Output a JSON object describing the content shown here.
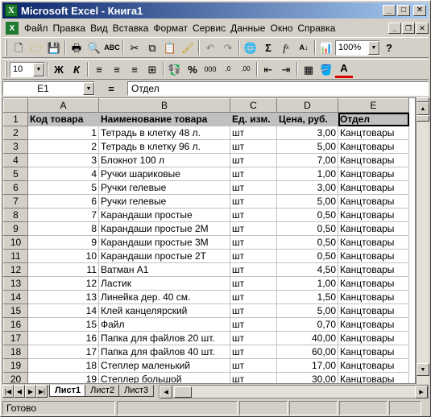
{
  "window": {
    "title": "Microsoft Excel - Книга1",
    "app_icon_letter": "X"
  },
  "menu": {
    "items": [
      "Файл",
      "Правка",
      "Вид",
      "Вставка",
      "Формат",
      "Сервис",
      "Данные",
      "Окно",
      "Справка"
    ]
  },
  "toolbar1": {
    "zoom": "100%"
  },
  "toolbar2": {
    "font_size": "10"
  },
  "formula_bar": {
    "cell_ref": "E1",
    "eq": "=",
    "content": "Отдел"
  },
  "grid": {
    "columns": [
      "A",
      "B",
      "C",
      "D",
      "E"
    ],
    "rows": [
      {
        "n": "1",
        "a": "Код товара",
        "b": "Наименование товара",
        "c": "Ед. изм.",
        "d": "Цена, руб.",
        "e": "Отдел"
      },
      {
        "n": "2",
        "a": "1",
        "b": "Тетрадь в клетку 48 л.",
        "c": "шт",
        "d": "3,00",
        "e": "Канцтовары"
      },
      {
        "n": "3",
        "a": "2",
        "b": "Тетрадь в клетку 96 л.",
        "c": "шт",
        "d": "5,00",
        "e": "Канцтовары"
      },
      {
        "n": "4",
        "a": "3",
        "b": "Блокнот 100 л",
        "c": "шт",
        "d": "7,00",
        "e": "Канцтовары"
      },
      {
        "n": "5",
        "a": "4",
        "b": "Ручки шариковые",
        "c": "шт",
        "d": "1,00",
        "e": "Канцтовары"
      },
      {
        "n": "6",
        "a": "5",
        "b": "Ручки гелевые",
        "c": "шт",
        "d": "3,00",
        "e": "Канцтовары"
      },
      {
        "n": "7",
        "a": "6",
        "b": "Ручки гелевые",
        "c": "шт",
        "d": "5,00",
        "e": "Канцтовары"
      },
      {
        "n": "8",
        "a": "7",
        "b": "Карандаши простые",
        "c": "шт",
        "d": "0,50",
        "e": "Канцтовары"
      },
      {
        "n": "9",
        "a": "8",
        "b": "Карандаши простые 2М",
        "c": "шт",
        "d": "0,50",
        "e": "Канцтовары"
      },
      {
        "n": "10",
        "a": "9",
        "b": "Карандаши простые 3М",
        "c": "шт",
        "d": "0,50",
        "e": "Канцтовары"
      },
      {
        "n": "11",
        "a": "10",
        "b": "Карандаши простые 2Т",
        "c": "шт",
        "d": "0,50",
        "e": "Канцтовары"
      },
      {
        "n": "12",
        "a": "11",
        "b": "Ватман А1",
        "c": "шт",
        "d": "4,50",
        "e": "Канцтовары"
      },
      {
        "n": "13",
        "a": "12",
        "b": "Ластик",
        "c": "шт",
        "d": "1,00",
        "e": "Канцтовары"
      },
      {
        "n": "14",
        "a": "13",
        "b": "Линейка дер. 40 см.",
        "c": "шт",
        "d": "1,50",
        "e": "Канцтовары"
      },
      {
        "n": "15",
        "a": "14",
        "b": "Клей канцелярский",
        "c": "шт",
        "d": "5,00",
        "e": "Канцтовары"
      },
      {
        "n": "16",
        "a": "15",
        "b": "Файл",
        "c": "шт",
        "d": "0,70",
        "e": "Канцтовары"
      },
      {
        "n": "17",
        "a": "16",
        "b": "Папка для файлов 20 шт.",
        "c": "шт",
        "d": "40,00",
        "e": "Канцтовары"
      },
      {
        "n": "18",
        "a": "17",
        "b": "Папка для файлов 40 шт.",
        "c": "шт",
        "d": "60,00",
        "e": "Канцтовары"
      },
      {
        "n": "19",
        "a": "18",
        "b": "Степлер маленький",
        "c": "шт",
        "d": "17,00",
        "e": "Канцтовары"
      },
      {
        "n": "20",
        "a": "19",
        "b": "Степлер большой",
        "c": "шт",
        "d": "30,00",
        "e": "Канцтовары"
      }
    ]
  },
  "sheets": {
    "tabs": [
      "Лист1",
      "Лист2",
      "Лист3"
    ],
    "active": "Лист1"
  },
  "status": {
    "text": "Готово"
  },
  "colors": {
    "titlebar_start": "#0a246a",
    "titlebar_end": "#a6caf0",
    "chrome": "#d4d0c8",
    "header_fill": "#c0c0c0",
    "icon_green": "#1d7a2e"
  }
}
